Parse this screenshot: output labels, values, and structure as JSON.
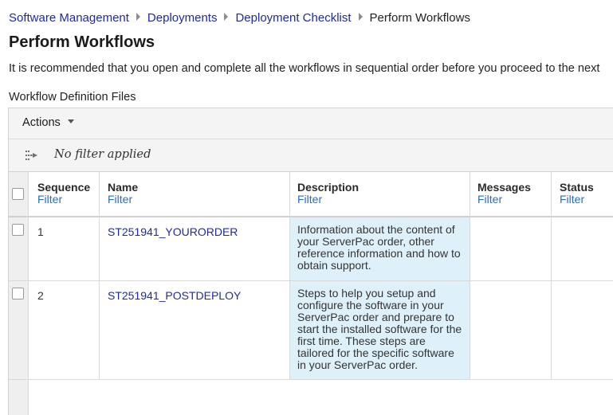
{
  "breadcrumb": {
    "items": [
      "Software Management",
      "Deployments",
      "Deployment Checklist"
    ],
    "current": "Perform Workflows"
  },
  "page": {
    "title": "Perform Workflows",
    "intro": "It is recommended that you open and complete all the workflows in sequential order before you proceed to the next",
    "section_label": "Workflow Definition Files"
  },
  "toolbar": {
    "actions_label": "Actions",
    "filter_status": "No filter applied"
  },
  "table": {
    "columns": [
      {
        "title": "Sequence",
        "filter": "Filter"
      },
      {
        "title": "Name",
        "filter": "Filter"
      },
      {
        "title": "Description",
        "filter": "Filter"
      },
      {
        "title": "Messages",
        "filter": "Filter"
      },
      {
        "title": "Status",
        "filter": "Filter"
      }
    ],
    "rows": [
      {
        "sequence": "1",
        "name": "ST251941_YOURORDER",
        "description": "Information about the content of your ServerPac order, other reference information and how to obtain support.",
        "messages": "",
        "status": ""
      },
      {
        "sequence": "2",
        "name": "ST251941_POSTDEPLOY",
        "description": "Steps to help you setup and configure the software in your ServerPac order and prepare to start the installed software for the first time. These steps are tailored for the specific software in your ServerPac order.",
        "messages": "",
        "status": ""
      }
    ]
  },
  "colors": {
    "link": "#1f2b9c",
    "filter_link": "#2d6db5",
    "description_highlight": "#def1fa"
  },
  "icons": {
    "caret": "chevron-down-icon",
    "filter": "filter-icon"
  }
}
